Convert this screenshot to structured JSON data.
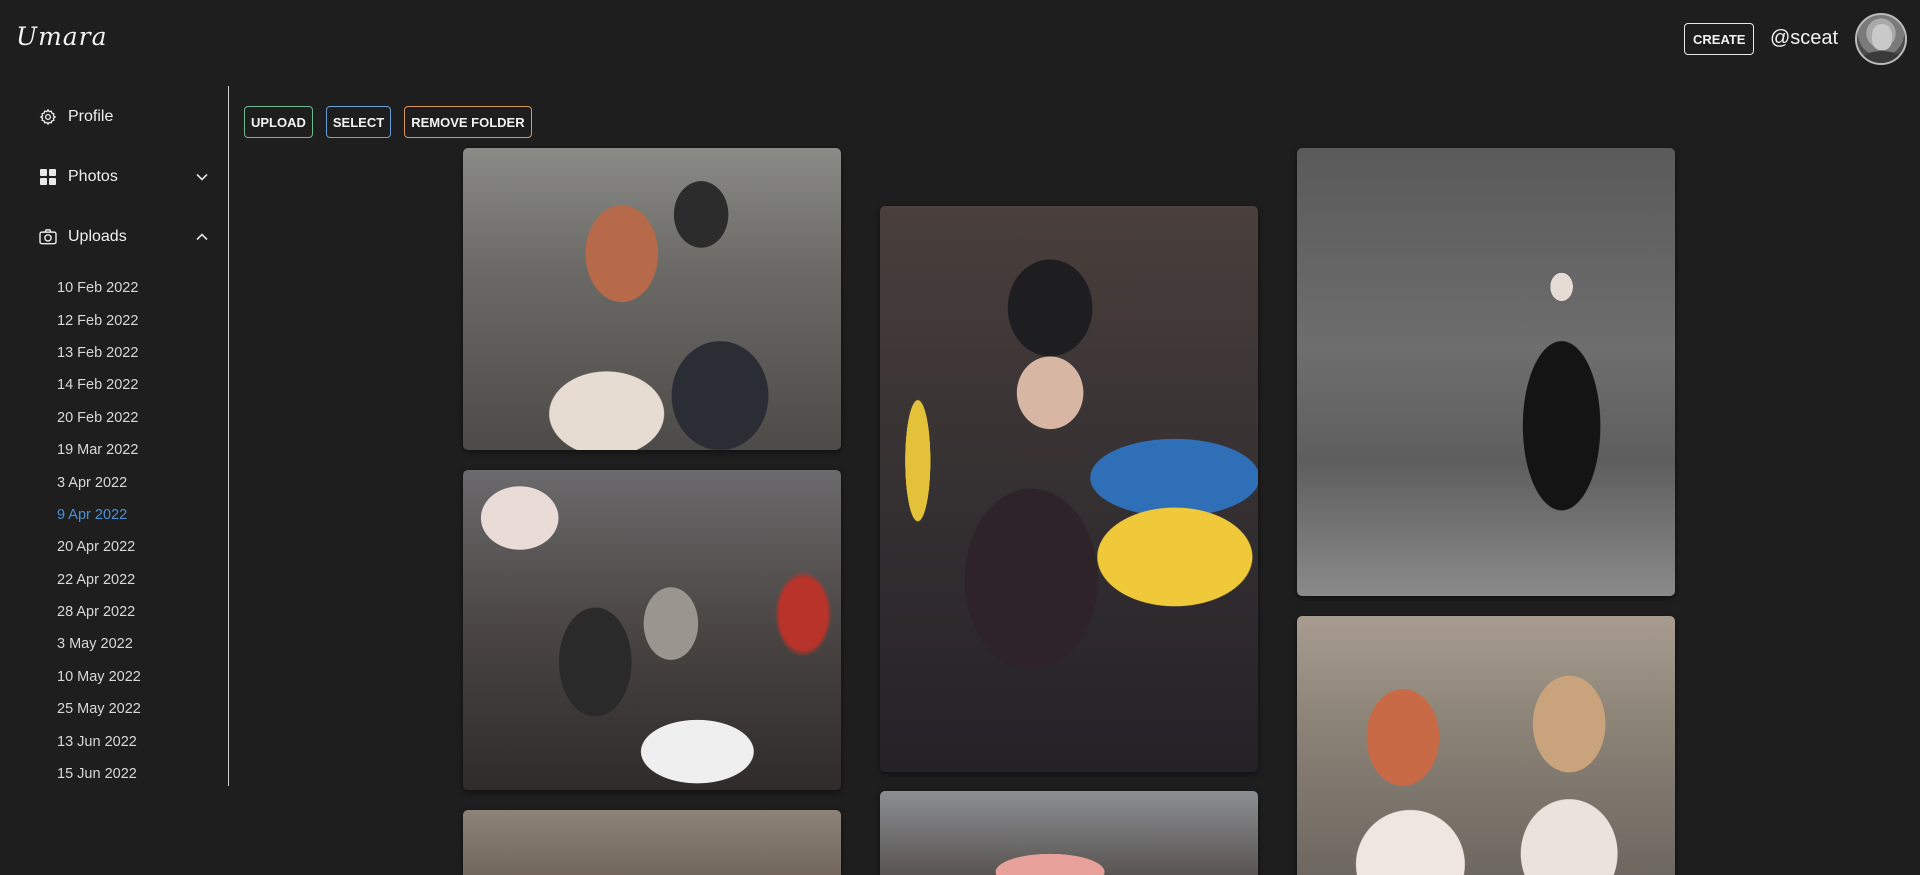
{
  "header": {
    "logo": "Umara",
    "create_label": "CREATE",
    "username": "@sceat"
  },
  "sidebar": {
    "items": [
      {
        "label": "Profile",
        "icon": "gear-icon"
      },
      {
        "label": "Photos",
        "icon": "grid-icon",
        "expanded": false
      },
      {
        "label": "Uploads",
        "icon": "camera-icon",
        "expanded": true
      }
    ],
    "upload_dates": [
      "10 Feb 2022",
      "12 Feb 2022",
      "13 Feb 2022",
      "14 Feb 2022",
      "20 Feb 2022",
      "19 Mar 2022",
      "3 Apr 2022",
      "9 Apr 2022",
      "20 Apr 2022",
      "22 Apr 2022",
      "28 Apr 2022",
      "3 May 2022",
      "10 May 2022",
      "25 May 2022",
      "13 Jun 2022",
      "15 Jun 2022"
    ],
    "active_date": "9 Apr 2022"
  },
  "toolbar": {
    "upload_label": "UPLOAD",
    "select_label": "SELECT",
    "remove_label": "REMOVE FOLDER"
  },
  "colors": {
    "background": "#1e1e1e",
    "active_date": "#4a90d9",
    "upload_border": "#6fb98f",
    "select_border": "#6aa0d8",
    "remove_border": "#d9955a"
  }
}
